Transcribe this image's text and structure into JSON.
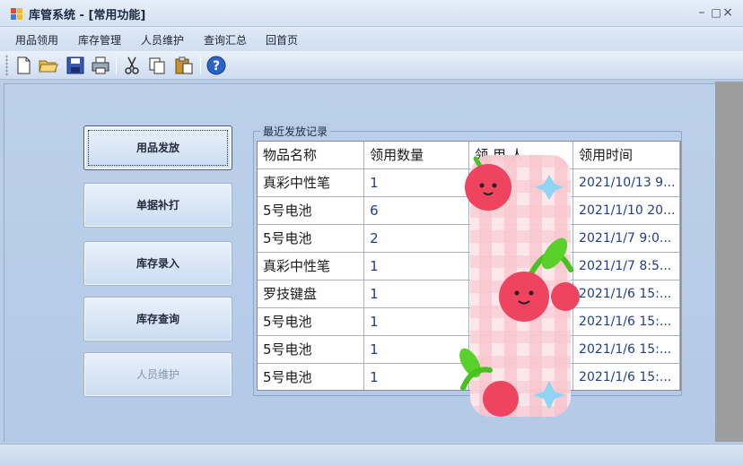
{
  "window": {
    "title": "库管系统 - [常用功能]",
    "minimize_glyph": "–",
    "restore_glyph": "□",
    "close_glyph": "×"
  },
  "menu": [
    "用品领用",
    "库存管理",
    "人员维护",
    "查询汇总",
    "回首页"
  ],
  "toolbar": [
    "new-icon",
    "open-folder-icon",
    "save-icon",
    "print-icon",
    "cut-icon",
    "copy-icon",
    "paste-icon",
    "help-icon"
  ],
  "side_buttons": [
    {
      "label": "用品发放",
      "state": "focused"
    },
    {
      "label": "单据补打",
      "state": "normal"
    },
    {
      "label": "库存录入",
      "state": "normal"
    },
    {
      "label": "库存查询",
      "state": "normal"
    },
    {
      "label": "人员维护",
      "state": "disabled"
    }
  ],
  "records": {
    "group_title": "最近发放记录",
    "columns": [
      "物品名称",
      "领用数量",
      "领 用 人",
      "领用时间"
    ],
    "rows": [
      {
        "item": "真彩中性笔",
        "qty": "1",
        "person": "",
        "time": "2021/10/13 9..."
      },
      {
        "item": "5号电池",
        "qty": "6",
        "person": "",
        "time": "2021/1/10 20..."
      },
      {
        "item": "5号电池",
        "qty": "2",
        "person": "",
        "time": "2021/1/7 9:0..."
      },
      {
        "item": "真彩中性笔",
        "qty": "1",
        "person": "",
        "time": "2021/1/7 8:5..."
      },
      {
        "item": "罗技键盘",
        "qty": "1",
        "person": "",
        "time": "2021/1/6 15:..."
      },
      {
        "item": "5号电池",
        "qty": "1",
        "person": "",
        "time": "2021/1/6 15:..."
      },
      {
        "item": "5号电池",
        "qty": "1",
        "person": "",
        "time": "2021/1/6 15:..."
      },
      {
        "item": "5号电池",
        "qty": "1",
        "person": "",
        "time": "2021/1/6 15:..."
      }
    ]
  },
  "colors": {
    "accent": "#cfdef1",
    "sticker_red": "#ee4460",
    "sticker_green": "#47c21f",
    "sticker_blue": "#8fd4f4"
  }
}
